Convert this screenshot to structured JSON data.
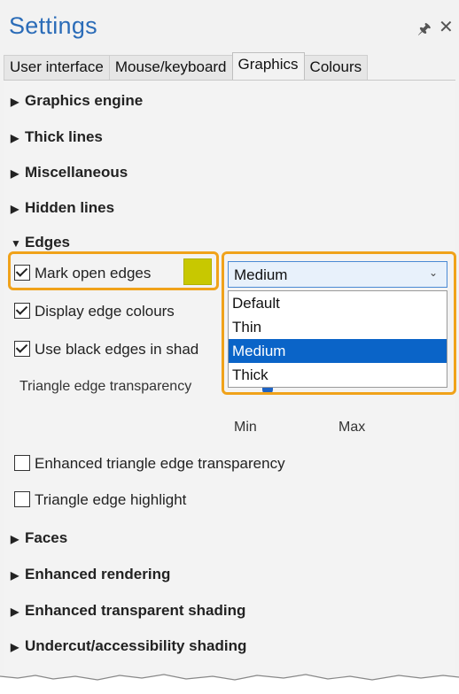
{
  "window": {
    "title": "Settings",
    "pin_label": "§",
    "close_label": "✕"
  },
  "tabs": [
    {
      "label": "User interface"
    },
    {
      "label": "Mouse/keyboard"
    },
    {
      "label": "Graphics"
    },
    {
      "label": "Colours"
    }
  ],
  "sections_top": [
    {
      "label": "Graphics engine",
      "arrow": "▶"
    },
    {
      "label": "Thick lines",
      "arrow": "▶"
    },
    {
      "label": "Miscellaneous",
      "arrow": "▶"
    },
    {
      "label": "Hidden lines",
      "arrow": "▶"
    },
    {
      "label": "Edges",
      "arrow": "▼"
    }
  ],
  "edges": {
    "mark_open_edges": {
      "label": "Mark open edges",
      "checked": true,
      "color": "#c8c800"
    },
    "display_edge_colours": {
      "label": "Display edge colours",
      "checked": true
    },
    "use_black_edges": {
      "label": "Use black edges in shad",
      "checked": true
    },
    "triangle_transparency_label": "Triangle edge transparency",
    "slider_min": "Min",
    "slider_max": "Max",
    "enhanced_transparency": {
      "label": "Enhanced triangle edge transparency",
      "checked": false
    },
    "triangle_highlight": {
      "label": "Triangle edge highlight",
      "checked": false
    }
  },
  "dropdown": {
    "selected": "Medium",
    "chevron": "⌄",
    "options": [
      "Default",
      "Thin",
      "Medium",
      "Thick"
    ]
  },
  "sections_bottom": [
    {
      "label": "Faces",
      "arrow": "▶"
    },
    {
      "label": "Enhanced rendering",
      "arrow": "▶"
    },
    {
      "label": "Enhanced transparent shading",
      "arrow": "▶"
    },
    {
      "label": "Undercut/accessibility shading",
      "arrow": "▶"
    }
  ],
  "colors": {
    "accent": "#2b6cb8",
    "highlight": "#f0a21a",
    "selection": "#0a64c8"
  }
}
